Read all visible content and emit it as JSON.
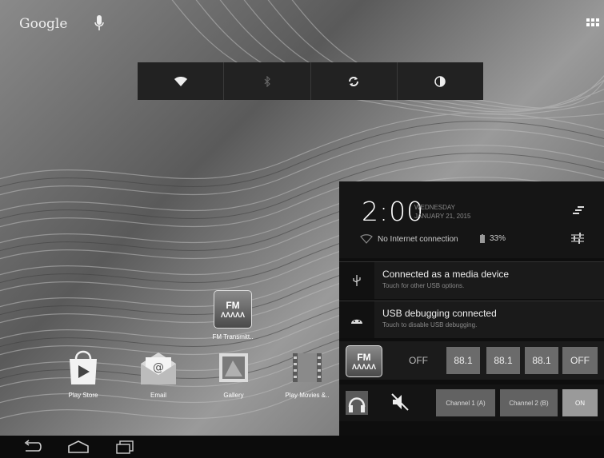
{
  "home": {
    "search_label": "Google",
    "apps": [
      {
        "label": "FM Transmitt..",
        "icon": "fm-transmitter-icon"
      },
      {
        "label": "Play Store",
        "icon": "play-store-icon"
      },
      {
        "label": "Email",
        "icon": "email-icon"
      },
      {
        "label": "Gallery",
        "icon": "gallery-icon"
      },
      {
        "label": "Play Movies &..",
        "icon": "play-movies-icon"
      }
    ]
  },
  "quick_settings": {
    "items": [
      "wifi-icon",
      "bluetooth-icon",
      "sync-icon",
      "brightness-icon"
    ]
  },
  "notification_panel": {
    "time": "2:00",
    "weekday": "WEDNESDAY",
    "date": "JANUARY 21, 2015",
    "network_status": "No Internet connection",
    "battery": "33%",
    "notifications": [
      {
        "title": "Connected as a media device",
        "subtitle": "Touch for other USB options.",
        "icon": "usb-icon"
      },
      {
        "title": "USB debugging connected",
        "subtitle": "Touch to disable USB debugging.",
        "icon": "android-debug-icon"
      }
    ],
    "fm": {
      "icon_label": "FM",
      "off_label": "OFF",
      "freq1": "88.1",
      "freq2": "88.1",
      "freq3": "88.1",
      "off_button": "OFF",
      "channel1": "Channel 1 (A)",
      "channel2": "Channel 2 (B)",
      "on_button": "ON"
    }
  },
  "colors": {
    "panel_bg": "#0e0e0e",
    "button_gray": "#6b6b6b",
    "navbar_bg": "#0c0c0c"
  }
}
